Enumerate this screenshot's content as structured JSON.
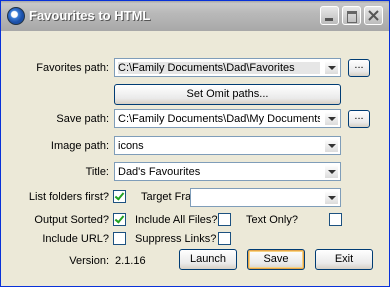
{
  "window": {
    "title": "Favourites to HTML"
  },
  "fields": {
    "favorites_path": {
      "label": "Favorites path:",
      "value": "C:\\Family Documents\\Dad\\Favorites",
      "browse": "..."
    },
    "omit_button": "Set Omit paths...",
    "save_path": {
      "label": "Save path:",
      "value": "C:\\Family Documents\\Dad\\My Documents",
      "browse": "..."
    },
    "image_path": {
      "label": "Image path:",
      "value": "icons"
    },
    "title": {
      "label": "Title:",
      "value": "Dad's Favourites"
    },
    "target_frame": {
      "label": "Target Frame:",
      "value": ""
    }
  },
  "options": {
    "list_folders_first": {
      "label": "List folders first?",
      "checked": true
    },
    "output_sorted": {
      "label": "Output Sorted?",
      "checked": true
    },
    "include_all_files": {
      "label": "Include All Files?",
      "checked": false
    },
    "text_only": {
      "label": "Text Only?",
      "checked": false
    },
    "include_url": {
      "label": "Include URL?",
      "checked": false
    },
    "suppress_links": {
      "label": "Suppress Links?",
      "checked": false
    }
  },
  "footer": {
    "version_label": "Version:",
    "version_value": "2.1.16",
    "launch": "Launch",
    "save": "Save",
    "exit": "Exit"
  }
}
